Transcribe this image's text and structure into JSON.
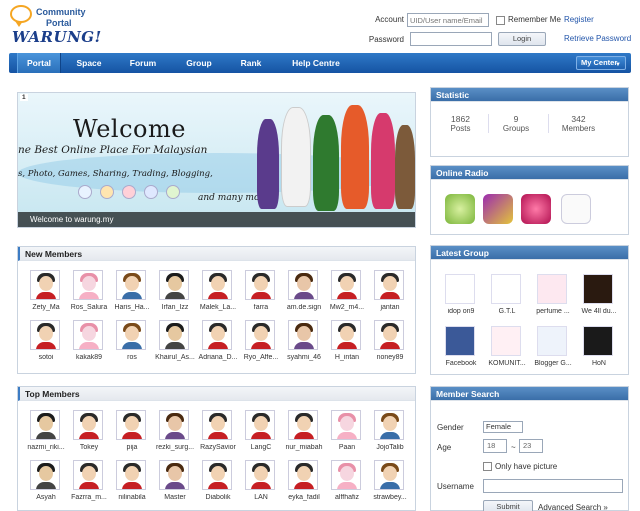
{
  "logo": {
    "line1": "Community",
    "line2": "Portal",
    "line3": "WARUNG!"
  },
  "login": {
    "account_label": "Account",
    "account_placeholder": "UID/User name/Email",
    "password_label": "Password",
    "remember_label": "Remember Me",
    "login_button": "Login",
    "register_link": "Register",
    "retrieve_link": "Retrieve Password"
  },
  "nav": {
    "items": [
      "Portal",
      "Space",
      "Forum",
      "Group",
      "Rank",
      "Help Centre"
    ],
    "active": "Portal",
    "my_center": "My Center"
  },
  "banner": {
    "number": "1",
    "welcome": "Welcome",
    "tagline": "ne Best Online Place For Malaysian",
    "tags": "s, Photo, Games, Sharing, Trading, Blogging,",
    "more": "and many more..",
    "caption": "Welcome to warung.my"
  },
  "new_members": {
    "title": "New Members",
    "members": [
      "Zety_Ma",
      "Ros_Salura",
      "Haris_Ha...",
      "Irfan_Izz",
      "Malek_La...",
      "farra",
      "am.de.sign",
      "Mw2_m4...",
      "jantan",
      "sotoi",
      "kakak89",
      "ros",
      "Khairul_As...",
      "Adriana_D...",
      "Ryo_Affe...",
      "syahmi_46",
      "H_intan",
      "noney89"
    ]
  },
  "top_members": {
    "title": "Top Members",
    "members": [
      "nazmi_riki...",
      "Tokey",
      "pija",
      "rezki_surg...",
      "RazySavior",
      "LangC",
      "nur_miabah",
      "Paan",
      "JojoTalib",
      "Asyah",
      "Fazrra_m...",
      "nilinabila",
      "Master",
      "Diabolik",
      "LAN",
      "eyka_fadil",
      "alffhafiz",
      "strawbey..."
    ]
  },
  "statistic": {
    "title": "Statistic",
    "items": [
      {
        "value": "1862",
        "label": "Posts"
      },
      {
        "value": "9",
        "label": "Groups"
      },
      {
        "value": "342",
        "label": "Members"
      }
    ]
  },
  "online_radio": {
    "title": "Online Radio"
  },
  "latest_group": {
    "title": "Latest Group",
    "groups": [
      "idop on9",
      "G.T.L",
      "perfume ...",
      "We 4ll du...",
      "Facebook",
      "KOMUNIT...",
      "Blogger G...",
      "HoN"
    ]
  },
  "member_search": {
    "title": "Member Search",
    "gender_label": "Gender",
    "gender_value": "Female",
    "age_label": "Age",
    "age_from": "18",
    "age_sep": "~",
    "age_to": "23",
    "only_picture_label": "Only have picture",
    "username_label": "Username",
    "submit_button": "Submit",
    "advanced_link": "Advanced Search »"
  }
}
